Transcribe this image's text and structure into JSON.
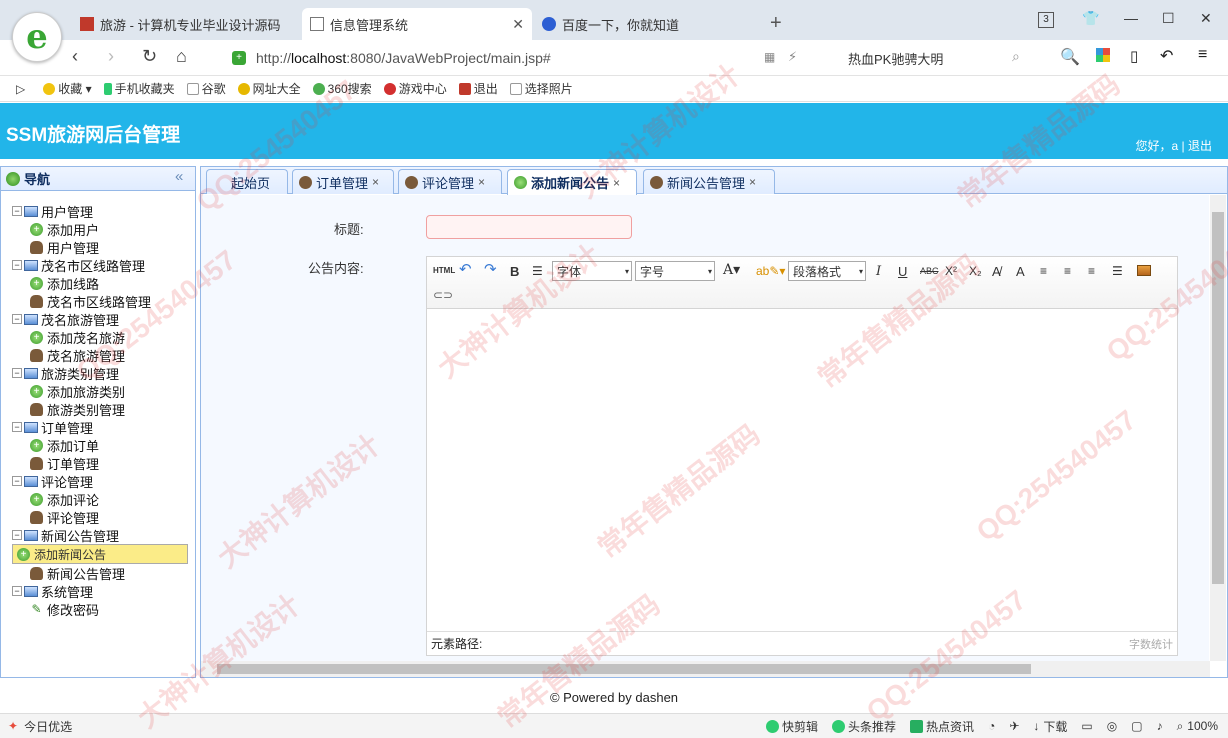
{
  "browser": {
    "tabs": [
      {
        "title": "旅游 - 计算机专业毕业设计源码"
      },
      {
        "title": "信息管理系统"
      },
      {
        "title": "百度一下，你就知道"
      }
    ],
    "tab_count": "3",
    "url_prefix": "http://",
    "url_host": "localhost",
    "url_rest": ":8080/JavaWebProject/main.jsp#",
    "search_text": "热血PK驰骋大明",
    "bookmarks": [
      "收藏",
      "手机收藏夹",
      "谷歌",
      "网址大全",
      "360搜索",
      "游戏中心",
      "退出",
      "选择照片"
    ]
  },
  "app": {
    "title": "SSM旅游网后台管理",
    "greeting": "您好，a | 退出",
    "footer": "© Powered by dashen"
  },
  "nav": {
    "title": "导航",
    "groups": [
      {
        "label": "用户管理",
        "items": [
          {
            "label": "添加用户",
            "icon": "add"
          },
          {
            "label": "用户管理",
            "icon": "user"
          }
        ]
      },
      {
        "label": "茂名市区线路管理",
        "items": [
          {
            "label": "添加线路",
            "icon": "add"
          },
          {
            "label": "茂名市区线路管理",
            "icon": "user"
          }
        ]
      },
      {
        "label": "茂名旅游管理",
        "items": [
          {
            "label": "添加茂名旅游",
            "icon": "add"
          },
          {
            "label": "茂名旅游管理",
            "icon": "user"
          }
        ]
      },
      {
        "label": "旅游类别管理",
        "items": [
          {
            "label": "添加旅游类别",
            "icon": "add"
          },
          {
            "label": "旅游类别管理",
            "icon": "user"
          }
        ]
      },
      {
        "label": "订单管理",
        "items": [
          {
            "label": "添加订单",
            "icon": "add"
          },
          {
            "label": "订单管理",
            "icon": "user"
          }
        ]
      },
      {
        "label": "评论管理",
        "items": [
          {
            "label": "添加评论",
            "icon": "add"
          },
          {
            "label": "评论管理",
            "icon": "user"
          }
        ]
      },
      {
        "label": "新闻公告管理",
        "items": [
          {
            "label": "添加新闻公告",
            "icon": "add",
            "selected": true
          },
          {
            "label": "新闻公告管理",
            "icon": "user"
          }
        ]
      },
      {
        "label": "系统管理",
        "items": [
          {
            "label": "修改密码",
            "icon": "pen"
          }
        ]
      }
    ]
  },
  "tabs": [
    {
      "label": "起始页",
      "closable": false
    },
    {
      "label": "订单管理",
      "closable": true
    },
    {
      "label": "评论管理",
      "closable": true
    },
    {
      "label": "添加新闻公告",
      "closable": true,
      "active": true
    },
    {
      "label": "新闻公告管理",
      "closable": true
    }
  ],
  "form": {
    "title_label": "标题:",
    "content_label": "公告内容:",
    "font_select": "字体",
    "size_select": "字号",
    "para_select": "段落格式",
    "path_label": "元素路径:",
    "word_count": "字数统计"
  },
  "statusbar": {
    "left": "今日优选",
    "items": [
      "快剪辑",
      "头条推荐",
      "热点资讯",
      "下载"
    ],
    "zoom": "100%"
  },
  "watermark": [
    "QQ:254540457",
    "大神计算机设计",
    "常年售精品源码"
  ]
}
